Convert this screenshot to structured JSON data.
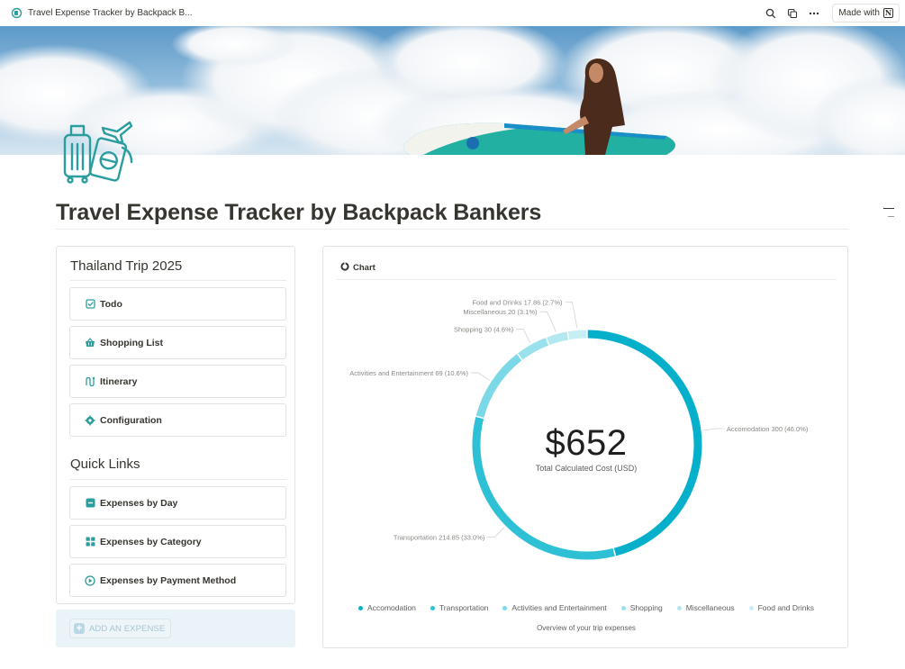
{
  "topbar": {
    "title": "Travel Expense Tracker by Backpack B...",
    "made_with_label": "Made with"
  },
  "page": {
    "title": "Travel Expense Tracker by Backpack Bankers"
  },
  "trip": {
    "title": "Thailand Trip 2025",
    "items": [
      {
        "label": "Todo",
        "icon": "checkbox-icon"
      },
      {
        "label": "Shopping List",
        "icon": "basket-icon"
      },
      {
        "label": "Itinerary",
        "icon": "route-icon"
      },
      {
        "label": "Configuration",
        "icon": "gear-icon"
      }
    ]
  },
  "quick_links": {
    "title": "Quick Links",
    "items": [
      {
        "label": "Expenses by Day",
        "icon": "minus-square-icon"
      },
      {
        "label": "Expenses by Category",
        "icon": "grid-icon"
      },
      {
        "label": "Expenses by Payment Method",
        "icon": "play-circle-icon"
      }
    ]
  },
  "add_expense": {
    "label": "ADD AN EXPENSE"
  },
  "chart_panel": {
    "heading": "Chart",
    "total": "$652",
    "total_label": "Total Calculated Cost (USD)",
    "caption": "Overview of your trip expenses"
  },
  "colors": {
    "accent": "#2a9d9f",
    "accomodation": "#06b0cb",
    "transportation": "#2ec1d6",
    "activities": "#7bd8e6",
    "shopping": "#98e1ed",
    "miscellaneous": "#b3e8f1",
    "food": "#c6eef5"
  },
  "chart_data": {
    "type": "pie",
    "variant": "donut",
    "categories": [
      "Accomodation",
      "Transportation",
      "Activities and Entertainment",
      "Shopping",
      "Miscellaneous",
      "Food and Drinks"
    ],
    "values": [
      300,
      214.85,
      69,
      30,
      20,
      17.86
    ],
    "slice_labels": [
      "Accomodation  300 (46.0%)",
      "Transportation  214.85 (33.0%)",
      "Activities and Entertainment  69 (10.6%)",
      "Shopping  30 (4.6%)",
      "Miscellaneous  20 (3.1%)",
      "Food and Drinks  17.86 (2.7%)"
    ],
    "colors": [
      "#06b0cb",
      "#2ec1d6",
      "#7bd8e6",
      "#98e1ed",
      "#b3e8f1",
      "#c6eef5"
    ],
    "legend_position": "bottom",
    "center_text": "$652",
    "center_subtext": "Total Calculated Cost (USD)"
  }
}
